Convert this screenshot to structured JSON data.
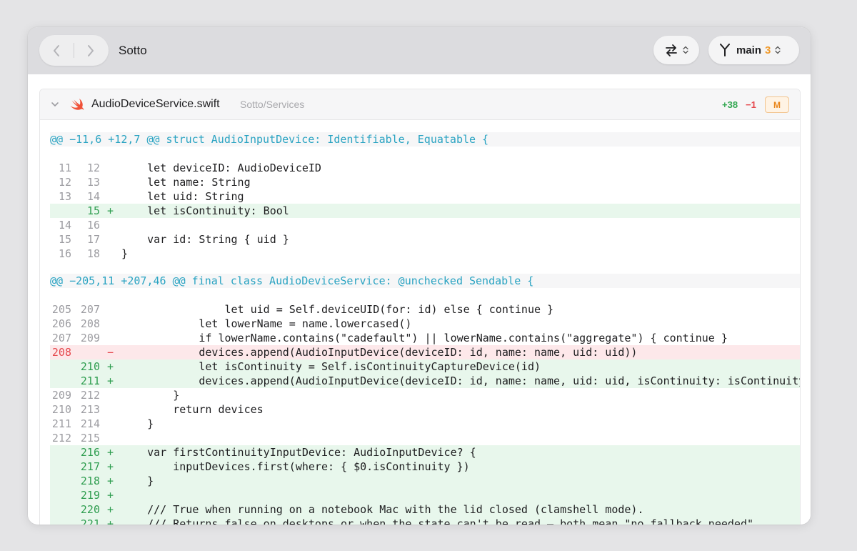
{
  "toolbar": {
    "title": "Sotto",
    "branch": "main",
    "branch_count": "3"
  },
  "file": {
    "name": "AudioDeviceService.swift",
    "path": "Sotto/Services",
    "additions": "+38",
    "deletions": "−1",
    "status": "M"
  },
  "colors": {
    "accent": "#f09a2c",
    "add": "#34a853",
    "del": "#e5484d",
    "hunk": "#29a3c2"
  },
  "diff": {
    "hunks": [
      {
        "header": "@@ −11,6 +12,7 @@ struct AudioInputDevice: Identifiable, Equatable {"
      },
      {
        "header": "@@ −205,11 +207,46 @@ final class AudioDeviceService: @unchecked Sendable {"
      }
    ],
    "lines": [
      {
        "type": "ctx",
        "old": "11",
        "new": "12",
        "sign": "",
        "code": "    let deviceID: AudioDeviceID"
      },
      {
        "type": "ctx",
        "old": "12",
        "new": "13",
        "sign": "",
        "code": "    let name: String"
      },
      {
        "type": "ctx",
        "old": "13",
        "new": "14",
        "sign": "",
        "code": "    let uid: String"
      },
      {
        "type": "add",
        "old": "",
        "new": "15",
        "sign": "+",
        "code": "    let isContinuity: Bool"
      },
      {
        "type": "ctx",
        "old": "14",
        "new": "16",
        "sign": "",
        "code": ""
      },
      {
        "type": "ctx",
        "old": "15",
        "new": "17",
        "sign": "",
        "code": "    var id: String { uid }"
      },
      {
        "type": "ctx",
        "old": "16",
        "new": "18",
        "sign": "",
        "code": "}"
      },
      {
        "type": "ctx",
        "old": "205",
        "new": "207",
        "sign": "",
        "code": "                let uid = Self.deviceUID(for: id) else { continue }"
      },
      {
        "type": "ctx",
        "old": "206",
        "new": "208",
        "sign": "",
        "code": "            let lowerName = name.lowercased()"
      },
      {
        "type": "ctx",
        "old": "207",
        "new": "209",
        "sign": "",
        "code": "            if lowerName.contains(\"cadefault\") || lowerName.contains(\"aggregate\") { continue }"
      },
      {
        "type": "del",
        "old": "208",
        "new": "",
        "sign": "−",
        "code": "            devices.append(AudioInputDevice(deviceID: id, name: name, uid: uid))"
      },
      {
        "type": "add",
        "old": "",
        "new": "210",
        "sign": "+",
        "code": "            let isContinuity = Self.isContinuityCaptureDevice(id)"
      },
      {
        "type": "add",
        "old": "",
        "new": "211",
        "sign": "+",
        "code": "            devices.append(AudioInputDevice(deviceID: id, name: name, uid: uid, isContinuity: isContinuity))"
      },
      {
        "type": "ctx",
        "old": "209",
        "new": "212",
        "sign": "",
        "code": "        }"
      },
      {
        "type": "ctx",
        "old": "210",
        "new": "213",
        "sign": "",
        "code": "        return devices"
      },
      {
        "type": "ctx",
        "old": "211",
        "new": "214",
        "sign": "",
        "code": "    }"
      },
      {
        "type": "ctx",
        "old": "212",
        "new": "215",
        "sign": "",
        "code": ""
      },
      {
        "type": "add",
        "old": "",
        "new": "216",
        "sign": "+",
        "code": "    var firstContinuityInputDevice: AudioInputDevice? {"
      },
      {
        "type": "add",
        "old": "",
        "new": "217",
        "sign": "+",
        "code": "        inputDevices.first(where: { $0.isContinuity })"
      },
      {
        "type": "add",
        "old": "",
        "new": "218",
        "sign": "+",
        "code": "    }"
      },
      {
        "type": "add",
        "old": "",
        "new": "219",
        "sign": "+",
        "code": ""
      },
      {
        "type": "add",
        "old": "",
        "new": "220",
        "sign": "+",
        "code": "    /// True when running on a notebook Mac with the lid closed (clamshell mode)."
      },
      {
        "type": "add",
        "old": "",
        "new": "221",
        "sign": "+",
        "code": "    /// Returns false on desktops or when the state can't be read — both mean \"no fallback needed\"."
      }
    ]
  }
}
